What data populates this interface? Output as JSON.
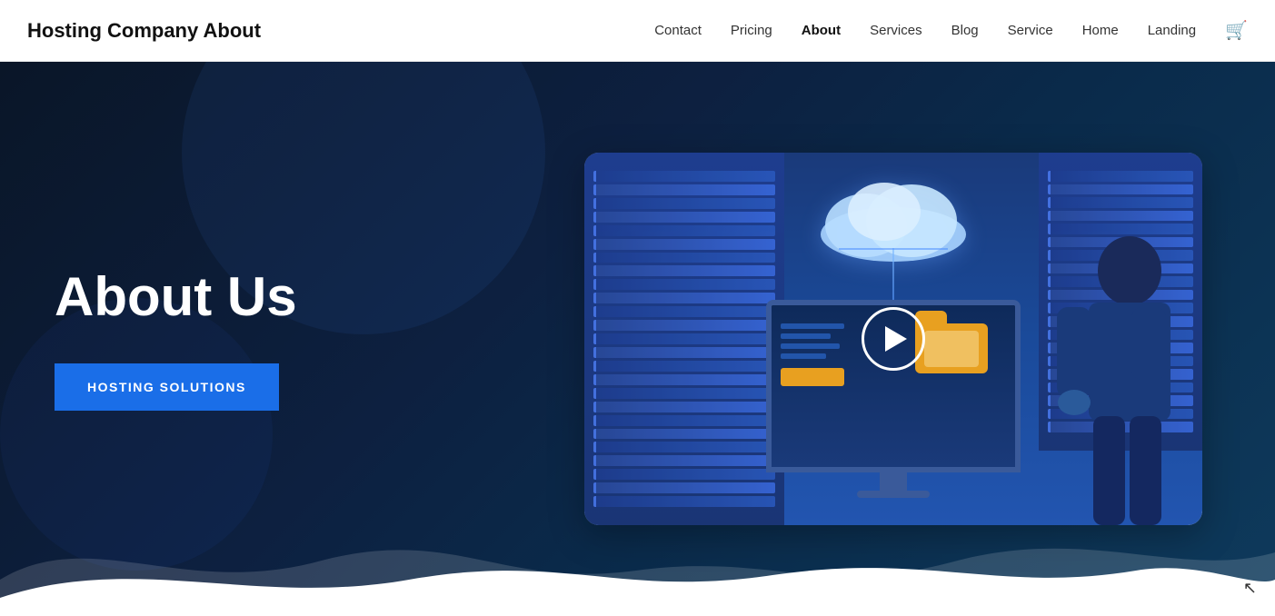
{
  "brand": {
    "name": "Hosting Company About"
  },
  "nav": {
    "items": [
      {
        "label": "Contact",
        "active": false
      },
      {
        "label": "Pricing",
        "active": false
      },
      {
        "label": "About",
        "active": true
      },
      {
        "label": "Services",
        "active": false
      },
      {
        "label": "Blog",
        "active": false
      },
      {
        "label": "Service",
        "active": false
      },
      {
        "label": "Home",
        "active": false
      },
      {
        "label": "Landing",
        "active": false
      }
    ]
  },
  "hero": {
    "title": "About Us",
    "button_label": "HOSTING SOLUTIONS"
  },
  "colors": {
    "accent": "#1a6ee8",
    "dark_bg": "#0a1628",
    "nav_bg": "#ffffff"
  }
}
